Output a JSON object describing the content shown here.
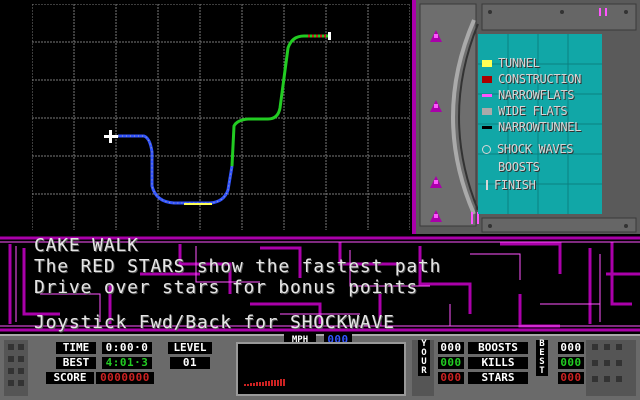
{
  "map": {
    "grid_color": "#7a7a7a",
    "course": {
      "start_marker": "start-plus",
      "colors": {
        "blue_section": "#3355ff",
        "green_section": "#22cc22",
        "red_stars": "#cc2222"
      }
    }
  },
  "legend": {
    "items": [
      {
        "label": "TUNNEL",
        "swatch": "#ffff55",
        "kind": "block",
        "name": "legend-tunnel"
      },
      {
        "label": "CONSTRUCTION",
        "swatch": "#aa0000",
        "kind": "block",
        "name": "legend-construction"
      },
      {
        "label": "NARROWFLATS",
        "swatch": "#ff55ff",
        "kind": "line",
        "name": "legend-narrow-flats"
      },
      {
        "label": "WIDE FLATS",
        "swatch": "#aaaaaa",
        "kind": "block",
        "name": "legend-wide-flats"
      },
      {
        "label": "NARROWTUNNEL",
        "swatch": "#000000",
        "kind": "line",
        "name": "legend-narrow-tunnel"
      },
      {
        "label": "SHOCK WAVES",
        "swatch": "none",
        "kind": "circle",
        "name": "legend-shock-waves"
      },
      {
        "label": "BOOSTS",
        "swatch": "none",
        "kind": "none",
        "name": "legend-boosts"
      },
      {
        "label": "FINISH",
        "swatch": "none",
        "kind": "bar",
        "name": "legend-finish"
      }
    ]
  },
  "message": {
    "track_name": "CAKE WALK",
    "line1": "The RED STARS show the fastest path",
    "line2": "Drive over stars for bonus points",
    "line3": "Joystick Fwd/Back for SHOCKWAVE"
  },
  "dashboard": {
    "time_label": "TIME",
    "time_value": "0:00·0",
    "best_label": "BEST",
    "best_value": "4:01·3",
    "score_label": "SCORE",
    "score_value": "0000000",
    "level_label": "LEVEL",
    "level_value": "01",
    "mph_label": "MPH",
    "mph_value": "000",
    "your_label": "YOUR",
    "best_side_label": "BEST",
    "boosts_label": "BOOSTS",
    "kills_label": "KILLS",
    "stars_label": "STARS",
    "your_boosts": "000",
    "your_kills": "000",
    "your_stars": "000",
    "best_boosts": "000",
    "best_kills": "000",
    "best_stars": "000"
  },
  "colors": {
    "purple": "#aa00aa",
    "magenta": "#ff55ff",
    "cyan_screen": "#11a7a7",
    "panel_grey": "#6a6a6a"
  }
}
